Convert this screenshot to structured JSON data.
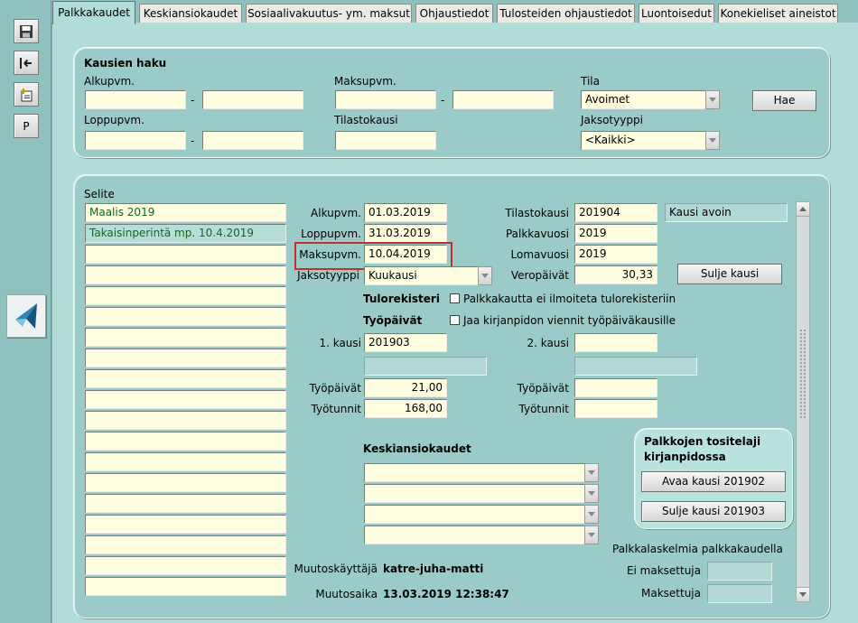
{
  "tabs": [
    "Palkkakaudet",
    "Keskiansiokaudet",
    "Sosiaalivakuutus- ym. maksut",
    "Ohjaustiedot",
    "Tulosteiden ohjaustiedot",
    "Luontoisedut",
    "Konekieliset aineistot"
  ],
  "toolbar": {
    "p_label": "P"
  },
  "search": {
    "title": "Kausien haku",
    "alkupvm_label": "Alkupvm.",
    "loppupvm_label": "Loppupvm.",
    "maksupvm_label": "Maksupvm.",
    "tilastokausi_label": "Tilastokausi",
    "tila_label": "Tila",
    "tila_value": "Avoimet",
    "jaksotyyppi_label": "Jaksotyyppi",
    "jaksotyyppi_value": "<Kaikki>",
    "dash": "-",
    "hae_label": "Hae"
  },
  "selite": {
    "label": "Selite",
    "items": [
      "Maalis 2019",
      "Takaisinperintä mp. 10.4.2019"
    ]
  },
  "details": {
    "alkupvm_label": "Alkupvm.",
    "alkupvm": "01.03.2019",
    "loppupvm_label": "Loppupvm.",
    "loppupvm": "31.03.2019",
    "maksupvm_label": "Maksupvm.",
    "maksupvm": "10.04.2019",
    "jaksotyyppi_label": "Jaksotyyppi",
    "jaksotyyppi": "Kuukausi",
    "tilastokausi_label": "Tilastokausi",
    "tilastokausi": "201904",
    "kausi_status": "Kausi avoin",
    "palkkavuosi_label": "Palkkavuosi",
    "palkkavuosi": "2019",
    "lomavuosi_label": "Lomavuosi",
    "lomavuosi": "2019",
    "veropaivat_label": "Veropäivät",
    "veropaivat": "30,33",
    "sulje_kausi_label": "Sulje kausi",
    "tulorekisteri_label": "Tulorekisteri",
    "tulorekisteri_chk": "Palkkakautta ei ilmoiteta tulorekisteriin",
    "tyopaivat_title": "Työpäivät",
    "tyopaivat_chk": "Jaa kirjanpidon viennit työpäiväkausille",
    "kausi1_label": "1. kausi",
    "kausi1": "201903",
    "kausi2_label": "2. kausi",
    "tyopaivat_label": "Työpäivät",
    "tyopaivat1": "21,00",
    "tyotunnit_label": "Työtunnit",
    "tyotunnit1": "168,00",
    "keskiansio_title": "Keskiansiokaudet"
  },
  "tositelaji": {
    "title_line1": "Palkkojen tositelaji",
    "title_line2": "kirjanpidossa",
    "avaa_label": "Avaa kausi 201902",
    "sulje_label": "Sulje kausi 201903"
  },
  "laskelmat": {
    "title": "Palkkalaskelmia palkkakaudella",
    "ei_maksettuja_label": "Ei maksettuja",
    "maksettuja_label": "Maksettuja"
  },
  "muutos": {
    "kayttaja_label": "Muutoskäyttäjä",
    "kayttaja": "katre-juha-matti",
    "aika_label": "Muutosaika",
    "aika": "13.03.2019 12:38:47"
  },
  "colors": {
    "accent_highlight": "#c0302e",
    "field_bg": "#fffee0",
    "panel_bg": "#9bcbc8"
  }
}
